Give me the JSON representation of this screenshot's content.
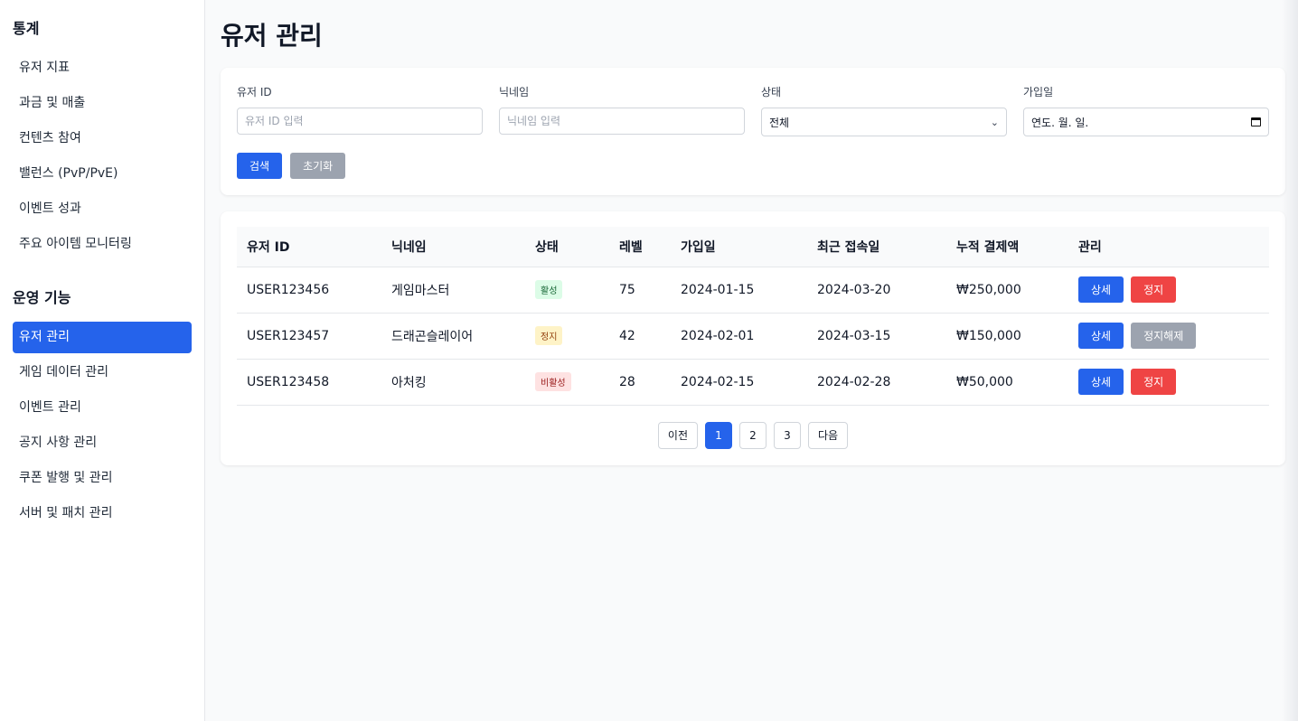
{
  "sidebar": {
    "section1_title": "통계",
    "section1_items": [
      "유저 지표",
      "과금 및 매출",
      "컨텐츠 참여",
      "밸런스 (PvP/PvE)",
      "이벤트 성과",
      "주요 아이템 모니터링"
    ],
    "section2_title": "운영 기능",
    "section2_items": [
      "유저 관리",
      "게임 데이터 관리",
      "이벤트 관리",
      "공지 사항 관리",
      "쿠폰 발행 및 관리",
      "서버 및 패치 관리"
    ]
  },
  "page": {
    "title": "유저 관리"
  },
  "filters": {
    "user_id": {
      "label": "유저 ID",
      "placeholder": "유저 ID 입력"
    },
    "nickname": {
      "label": "닉네임",
      "placeholder": "닉네임 입력"
    },
    "status": {
      "label": "상태",
      "value": "전체"
    },
    "join_date": {
      "label": "가입일",
      "value": "연도. 월. 일."
    },
    "search_label": "검색",
    "reset_label": "초기화"
  },
  "table": {
    "headers": [
      "유저 ID",
      "닉네임",
      "상태",
      "레벨",
      "가입일",
      "최근 접속일",
      "누적 결제액",
      "관리"
    ],
    "rows": [
      {
        "id": "USER123456",
        "nickname": "게임마스터",
        "status": "활성",
        "level": "75",
        "joined": "2024-01-15",
        "last_login": "2024-03-20",
        "total_paid": "₩250,000",
        "detail": "상세",
        "action": "정지"
      },
      {
        "id": "USER123457",
        "nickname": "드래곤슬레이어",
        "status": "정지",
        "level": "42",
        "joined": "2024-02-01",
        "last_login": "2024-03-15",
        "total_paid": "₩150,000",
        "detail": "상세",
        "action": "정지해제"
      },
      {
        "id": "USER123458",
        "nickname": "아처킹",
        "status": "비활성",
        "level": "28",
        "joined": "2024-02-15",
        "last_login": "2024-02-28",
        "total_paid": "₩50,000",
        "detail": "상세",
        "action": "정지"
      }
    ]
  },
  "pagination": {
    "prev": "이전",
    "pages": [
      "1",
      "2",
      "3"
    ],
    "next": "다음",
    "current": "1"
  },
  "colors": {
    "accent": "#2563eb",
    "danger": "#ef4444",
    "muted": "#9ca3af"
  }
}
